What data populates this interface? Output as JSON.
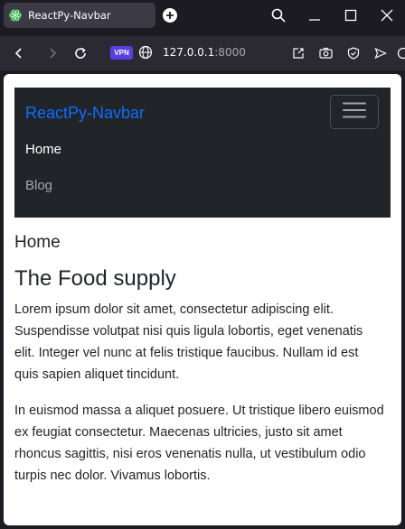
{
  "browser": {
    "tab_title": "ReactPy-Navbar",
    "vpn_label": "VPN",
    "url_host": "127.0.0.1",
    "url_port": ":8000"
  },
  "app": {
    "brand": "ReactPy-Navbar",
    "nav_items": [
      {
        "label": "Home",
        "active": true
      },
      {
        "label": "Blog",
        "active": false
      }
    ]
  },
  "content": {
    "page_heading": "Home",
    "title": "The Food supply",
    "paragraphs": [
      "Lorem ipsum dolor sit amet, consectetur adipiscing elit. Suspendisse volutpat nisi quis ligula lobortis, eget venenatis elit. Integer vel nunc at felis tristique faucibus. Nullam id est quis sapien aliquet tincidunt.",
      "In euismod massa a aliquet posuere. Ut tristique libero euismod ex feugiat consectetur. Maecenas ultricies, justo sit amet rhoncus sagittis, nisi eros venenatis nulla, ut vestibulum odio turpis nec dolor. Vivamus lobortis."
    ]
  },
  "colors": {
    "brand": "#0d6efd",
    "navbar_bg": "#212529",
    "vpn_badge": "#5a3fe0"
  },
  "icons": [
    "reactpy-tab-icon",
    "new-tab-icon",
    "search-icon",
    "minimize-icon",
    "maximize-icon",
    "close-icon",
    "back-icon",
    "forward-icon",
    "reload-icon",
    "globe-icon",
    "share-icon",
    "screenshot-icon",
    "shield-icon",
    "extension-icon",
    "send-icon",
    "hamburger-icon"
  ]
}
